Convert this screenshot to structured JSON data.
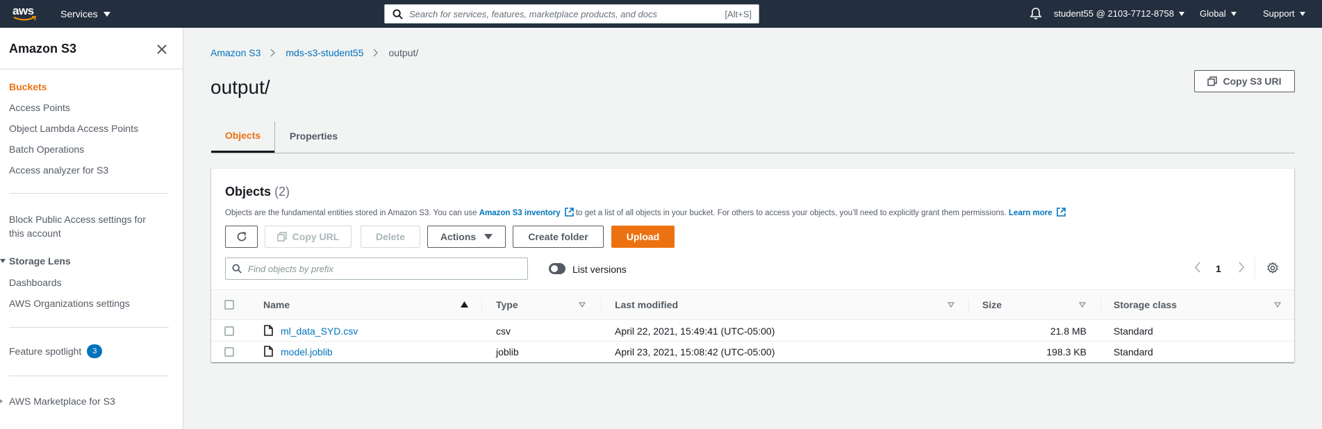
{
  "topnav": {
    "logo": "aws",
    "services_label": "Services",
    "search_placeholder": "Search for services, features, marketplace products, and docs",
    "search_shortcut": "[Alt+S]",
    "account_label": "student55 @ 2103-7712-8758",
    "region_label": "Global",
    "support_label": "Support"
  },
  "sidebar": {
    "title": "Amazon S3",
    "items": [
      {
        "label": "Buckets",
        "active": true
      },
      {
        "label": "Access Points"
      },
      {
        "label": "Object Lambda Access Points"
      },
      {
        "label": "Batch Operations"
      },
      {
        "label": "Access analyzer for S3"
      }
    ],
    "block_public_line1": "Block Public Access settings for",
    "block_public_line2": "this account",
    "storage_lens": {
      "title": "Storage Lens",
      "items": [
        {
          "label": "Dashboards"
        },
        {
          "label": "AWS Organizations settings"
        }
      ]
    },
    "feature_spotlight": {
      "label": "Feature spotlight",
      "badge": "3"
    },
    "marketplace": "AWS Marketplace for S3"
  },
  "breadcrumb": [
    {
      "label": "Amazon S3"
    },
    {
      "label": "mds-s3-student55"
    },
    {
      "label": "output/"
    }
  ],
  "page": {
    "title": "output/",
    "copy_uri_label": "Copy S3 URI"
  },
  "tabs": [
    {
      "label": "Objects",
      "active": true
    },
    {
      "label": "Properties"
    }
  ],
  "objects": {
    "heading": "Objects",
    "count": "(2)",
    "desc_before": "Objects are the fundamental entities stored in Amazon S3. You can use ",
    "desc_link1": "Amazon S3 inventory",
    "desc_middle": " to get a list of all objects in your bucket. For others to access your objects, you’ll need to explicitly grant them permissions. ",
    "desc_link2": "Learn more",
    "buttons": {
      "copy_url": "Copy URL",
      "delete": "Delete",
      "actions": "Actions",
      "create_folder": "Create folder",
      "upload": "Upload"
    },
    "find_placeholder": "Find objects by prefix",
    "list_versions_label": "List versions",
    "page_number": "1",
    "columns": [
      "Name",
      "Type",
      "Last modified",
      "Size",
      "Storage class"
    ],
    "rows": [
      {
        "name": "ml_data_SYD.csv",
        "type": "csv",
        "modified": "April 22, 2021, 15:49:41 (UTC-05:00)",
        "size": "21.8 MB",
        "storage": "Standard"
      },
      {
        "name": "model.joblib",
        "type": "joblib",
        "modified": "April 23, 2021, 15:08:42 (UTC-05:00)",
        "size": "198.3 KB",
        "storage": "Standard"
      }
    ]
  },
  "colors": {
    "nav_bg": "#232f3e",
    "accent_orange": "#ec7211",
    "link_blue": "#0073bb",
    "badge_blue": "#0073bb"
  }
}
